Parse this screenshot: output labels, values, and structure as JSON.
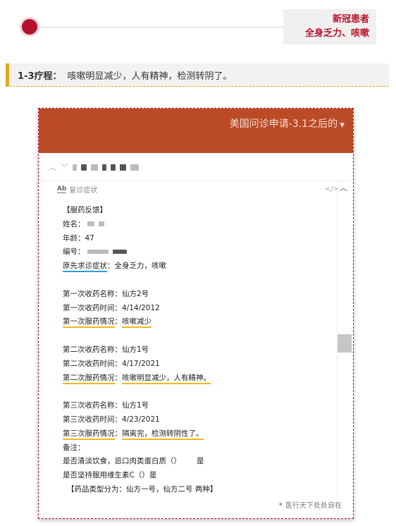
{
  "header": {
    "tag_line1": "新冠患者",
    "tag_line2": "全身乏力、咳嗽",
    "accent": "#b5122b"
  },
  "course": {
    "label": "1-3疗程：",
    "text": "咳嗽明显减少，人有精神，检测转阴了。"
  },
  "screenshot": {
    "app_title": "美国问诊申请-3.1之后的",
    "header_color": "#bb4b27",
    "toolbar_icons": [
      "chevron-up-icon",
      "chevron-down-icon"
    ],
    "pane_title": "复诊症状",
    "doc": {
      "heading": "【服药反馈】",
      "name_label": "姓名：",
      "age_label": "年龄：",
      "age_value": "47",
      "id_label": "编号：",
      "orig_symptom_label": "原先求诊症状",
      "orig_symptom_value": "：全身乏力，咳嗽",
      "r1_name": "第一次收药名称：仙方2号",
      "r1_time": "第一次收药时间：4/14/2012",
      "r1_status_label": "第一次服药情况",
      "r1_status_sep": "：",
      "r1_status_value": "咳嗽减少",
      "r2_name": "第二次收药名称：仙方1号",
      "r2_time": "第二次收药时间：4/17/2021",
      "r2_status_label": "第二次服药情况",
      "r2_status_sep": "：",
      "r2_status_value": "咳嗽明显减少，人有精神。",
      "r3_name": "第三次收药名称：仙方1号",
      "r3_time": "第三次收药时间：4/23/2021",
      "r3_status_label": "第三次服药情况",
      "r3_status_sep": "：",
      "r3_status_value": "隔离完，检测转阴性了。",
      "note_label": "备注：",
      "q1": "是否清淡饮食，忌口肉类蛋白质（）",
      "q1_answer": "是",
      "q2": "是否坚持服用维生素C（）是",
      "types": "【药品类型分为：仙方一号，仙方二号 两种】"
    },
    "watermark": "医行天下处处自在"
  }
}
